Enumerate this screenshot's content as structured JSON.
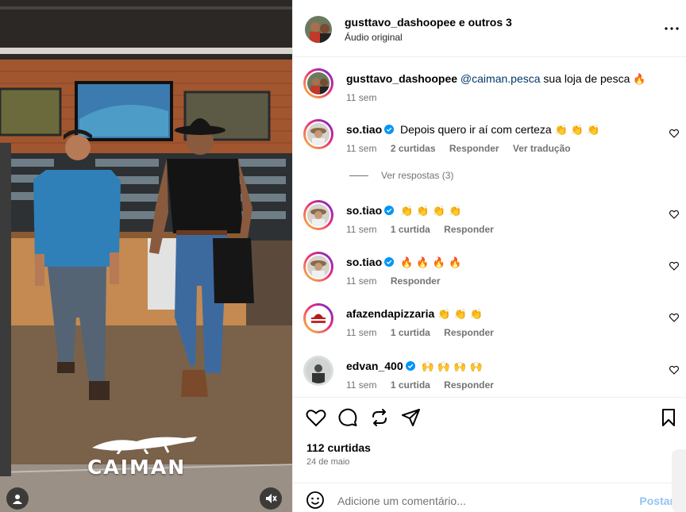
{
  "media": {
    "brand_text": "CAIMAN",
    "icons": {
      "user": "user-tag-icon",
      "mute": "muted-speaker-icon"
    }
  },
  "header": {
    "author": "gusttavo_dashoopee e outros 3",
    "audio": "Áudio original",
    "more_icon": "more-horizontal-icon"
  },
  "caption": {
    "username": "gusttavo_dashoopee",
    "mention": "@caiman.pesca",
    "text": " sua loja de pesca",
    "emoji": "🔥",
    "time": "11 sem"
  },
  "comments": [
    {
      "username": "so.tiao",
      "verified": true,
      "text": "Depois quero ir aí com certeza",
      "emoji": "👏 👏 👏",
      "time": "11 sem",
      "likes": "2 curtidas",
      "reply": "Responder",
      "translate": "Ver tradução"
    },
    {
      "username": "so.tiao",
      "verified": true,
      "text": "",
      "emoji": "👏 👏 👏 👏",
      "time": "11 sem",
      "likes": "1 curtida",
      "reply": "Responder"
    },
    {
      "username": "so.tiao",
      "verified": true,
      "text": "",
      "emoji": "🔥 🔥 🔥 🔥",
      "time": "11 sem",
      "likes": "",
      "reply": "Responder"
    },
    {
      "username": "afazendapizzaria",
      "verified": false,
      "text": "",
      "emoji": "👏 👏 👏",
      "time": "11 sem",
      "likes": "1 curtida",
      "reply": "Responder"
    },
    {
      "username": "edvan_400",
      "verified": true,
      "text": "",
      "emoji": "🙌 🙌 🙌 🙌",
      "time": "11 sem",
      "likes": "1 curtida",
      "reply": "Responder"
    }
  ],
  "view_replies": "Ver respostas (3)",
  "footer": {
    "likes": "112 curtidas",
    "date": "24 de maio",
    "placeholder": "Adicione um comentário...",
    "post": "Postar"
  },
  "colors": {
    "link": "#00376b",
    "verified": "#0095f6",
    "meta": "#737373",
    "post_disabled": "#95c3f2"
  }
}
